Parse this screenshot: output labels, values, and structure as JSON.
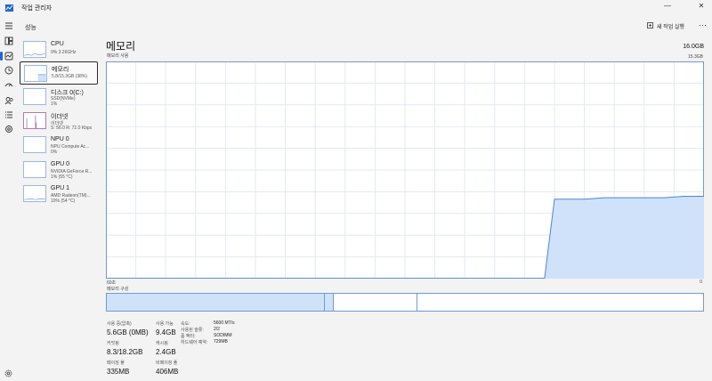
{
  "window": {
    "title": "작업 관리자",
    "minimize": "—",
    "close": "✕"
  },
  "header": {
    "page_title": "성능",
    "run_task": "새 작업 실행",
    "more": "···"
  },
  "devices": [
    {
      "name": "CPU",
      "sub1": "9% 3.26GHz",
      "sub2": ""
    },
    {
      "name": "메모리",
      "sub1": "5.8/15.3GB (38%)",
      "sub2": ""
    },
    {
      "name": "디스크 0(C:)",
      "sub1": "SSD(NVMe)",
      "sub2": "1%"
    },
    {
      "name": "이더넷",
      "sub1": "이더넷",
      "sub2": "S: 56.0 R: 72.0 Kbps"
    },
    {
      "name": "NPU 0",
      "sub1": "NPU Compute Ac...",
      "sub2": "0%"
    },
    {
      "name": "GPU 0",
      "sub1": "NVIDIA GeForce R...",
      "sub2": "1% (55 °C)"
    },
    {
      "name": "GPU 1",
      "sub1": "AMD Radeon(TM)...",
      "sub2": "10% (54 °C)"
    }
  ],
  "main": {
    "title": "메모리",
    "total": "16.0GB",
    "chart_label": "메모리 사용",
    "chart_max": "15.3GB",
    "axis_left": "60초",
    "axis_right": "0",
    "composition_label": "메모리 구성"
  },
  "chart_data": {
    "type": "area",
    "title": "메모리 사용",
    "xlabel": "",
    "ylabel": "",
    "xlim": [
      60,
      0
    ],
    "ylim": [
      0,
      15.3
    ],
    "grid": true,
    "x": [
      60,
      16,
      15,
      12,
      10,
      8,
      6,
      4,
      2,
      0
    ],
    "series": [
      {
        "name": "",
        "values": [
          0,
          0,
          5.6,
          5.6,
          5.7,
          5.7,
          5.7,
          5.7,
          5.8,
          5.8
        ]
      }
    ],
    "color": "#cfe2fa",
    "line_color": "#4a86d4"
  },
  "composition": [
    {
      "name": "in-use",
      "fraction": 0.365,
      "color": "#cfe2fa"
    },
    {
      "name": "modified",
      "fraction": 0.016,
      "color": "#cfe2fa"
    },
    {
      "name": "standby",
      "fraction": 0.14,
      "color": "#ffffff"
    },
    {
      "name": "free",
      "fraction": 0.479,
      "color": "#ffffff"
    }
  ],
  "stats": {
    "in_use_label": "사용 중(압축)",
    "in_use_value": "5.6GB (0MB)",
    "available_label": "사용 가능",
    "available_value": "9.4GB",
    "committed_label": "커밋됨",
    "committed_value": "8.3/18.2GB",
    "cached_label": "캐시됨",
    "cached_value": "2.4GB",
    "paged_label": "페이징 풀",
    "paged_value": "335MB",
    "nonpaged_label": "비페이징 풀",
    "nonpaged_value": "406MB",
    "speed_label": "속도:",
    "speed_value": "5600 MT/s",
    "slots_label": "사용된 슬롯:",
    "slots_value": "2/2",
    "form_label": "폼 팩터:",
    "form_value": "SODIMM",
    "reserved_label": "하드웨어 예약:",
    "reserved_value": "729MB"
  },
  "icons": [
    "menu-icon",
    "processes-icon",
    "performance-icon",
    "history-icon",
    "startup-icon",
    "users-icon",
    "details-icon",
    "services-icon",
    "settings-icon"
  ]
}
